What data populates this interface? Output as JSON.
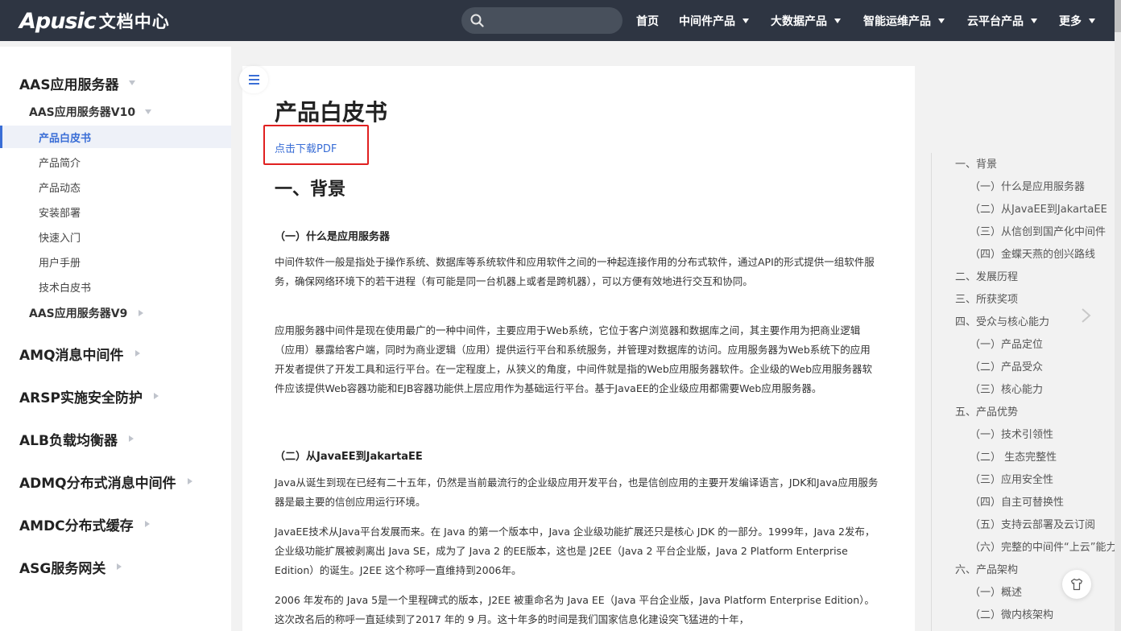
{
  "header": {
    "logo_mark": "Apusic",
    "logo_sub": "文档中心",
    "search": {
      "placeholder": ""
    },
    "nav": [
      {
        "label": "首页",
        "has_caret": false
      },
      {
        "label": "中间件产品",
        "has_caret": true
      },
      {
        "label": "大数据产品",
        "has_caret": true
      },
      {
        "label": "智能运维产品",
        "has_caret": true
      },
      {
        "label": "云平台产品",
        "has_caret": true
      },
      {
        "label": "更多",
        "has_caret": true
      }
    ]
  },
  "sidebar": {
    "items": [
      {
        "label": "AAS应用服务器",
        "level": 1,
        "expanded": true
      },
      {
        "label": "AAS应用服务器V10",
        "level": 2,
        "expanded": true
      },
      {
        "label": "产品白皮书",
        "level": 3,
        "active": true
      },
      {
        "label": "产品简介",
        "level": 3
      },
      {
        "label": "产品动态",
        "level": 3
      },
      {
        "label": "安装部署",
        "level": 3
      },
      {
        "label": "快速入门",
        "level": 3
      },
      {
        "label": "用户手册",
        "level": 3
      },
      {
        "label": "技术白皮书",
        "level": 3
      },
      {
        "label": "AAS应用服务器V9",
        "level": 2,
        "expanded": false
      },
      {
        "label": "AMQ消息中间件",
        "level": 1,
        "expanded": false
      },
      {
        "label": "ARSP实施安全防护",
        "level": 1,
        "expanded": false
      },
      {
        "label": "ALB负载均衡器",
        "level": 1,
        "expanded": false
      },
      {
        "label": "ADMQ分布式消息中间件",
        "level": 1,
        "expanded": false
      },
      {
        "label": "AMDC分布式缓存",
        "level": 1,
        "expanded": false
      },
      {
        "label": "ASG服务网关",
        "level": 1,
        "expanded": false
      }
    ]
  },
  "content": {
    "title": "产品白皮书",
    "download_link": "点击下载PDF",
    "section1": "一、背景",
    "sub1": "（一）什么是应用服务器",
    "p1": "中间件软件一般是指处于操作系统、数据库等系统软件和应用软件之间的一种起连接作用的分布式软件，通过API的形式提供一组软件服务，确保网络环境下的若干进程（有可能是同一台机器上或者是跨机器），可以方便有效地进行交互和协同。",
    "p2": "应用服务器中间件是现在使用最广的一种中间件，主要应用于Web系统，它位于客户浏览器和数据库之间，其主要作用为把商业逻辑（应用）暴露给客户端，同时为商业逻辑（应用）提供运行平台和系统服务，并管理对数据库的访问。应用服务器为Web系统下的应用开发者提供了开发工具和运行平台。在一定程度上，从狭义的角度，中间件就是指的Web应用服务器软件。企业级的Web应用服务器软件应该提供Web容器功能和EJB容器功能供上层应用作为基础运行平台。基于JavaEE的企业级应用都需要Web应用服务器。",
    "sub2": "（二）从JavaEE到JakartaEE",
    "p3": "Java从诞生到现在已经有二十五年，仍然是当前最流行的企业级应用开发平台，也是信创应用的主要开发编译语言，JDK和Java应用服务器是最主要的信创应用运行环境。",
    "p4": "JavaEE技术从Java平台发展而来。在 Java 的第一个版本中，Java 企业级功能扩展还只是核心 JDK 的一部分。1999年，Java 2发布，企业级功能扩展被剥离出 Java SE，成为了 Java 2 的EE版本，这也是 J2EE（Java 2 平台企业版，Java 2 Platform Enterprise Edition）的诞生。J2EE 这个称呼一直维持到2006年。",
    "p5": "2006 年发布的 Java 5是一个里程碑式的版本，J2EE 被重命名为 Java EE（Java 平台企业版，Java Platform Enterprise Edition）。这次改名后的称呼一直延续到了2017 年的 9 月。这十年多的时间是我们国家信息化建设突飞猛进的十年，"
  },
  "toc": {
    "items": [
      {
        "label": "一、背景",
        "level": 1
      },
      {
        "label": "（一）什么是应用服务器",
        "level": 2
      },
      {
        "label": "（二）从JavaEE到JakartaEE",
        "level": 2
      },
      {
        "label": "（三）从信创到国产化中间件",
        "level": 2
      },
      {
        "label": "（四）金蝶天燕的创兴路线",
        "level": 2
      },
      {
        "label": "二、发展历程",
        "level": 1
      },
      {
        "label": "三、所获奖项",
        "level": 1
      },
      {
        "label": "四、受众与核心能力",
        "level": 1
      },
      {
        "label": "（一）产品定位",
        "level": 2
      },
      {
        "label": "（二）产品受众",
        "level": 2
      },
      {
        "label": "（三）核心能力",
        "level": 2
      },
      {
        "label": "五、产品优势",
        "level": 1
      },
      {
        "label": "（一）技术引领性",
        "level": 2
      },
      {
        "label": "（二） 生态完整性",
        "level": 2
      },
      {
        "label": "（三）应用安全性",
        "level": 2
      },
      {
        "label": "（四）自主可替换性",
        "level": 2
      },
      {
        "label": "（五）支持云部署及云订阅",
        "level": 2
      },
      {
        "label": "（六）完整的中间件“上云”能力",
        "level": 2
      },
      {
        "label": "六、产品架构",
        "level": 1
      },
      {
        "label": "（一）概述",
        "level": 2
      },
      {
        "label": "（二）微内核架构",
        "level": 2
      }
    ]
  },
  "colors": {
    "topbar": "#2e3542",
    "accent": "#3a6ed6",
    "highlight_box": "#e02020"
  },
  "icons": [
    "search-icon",
    "menu-icon",
    "chevron-right-icon",
    "shirt-icon"
  ]
}
